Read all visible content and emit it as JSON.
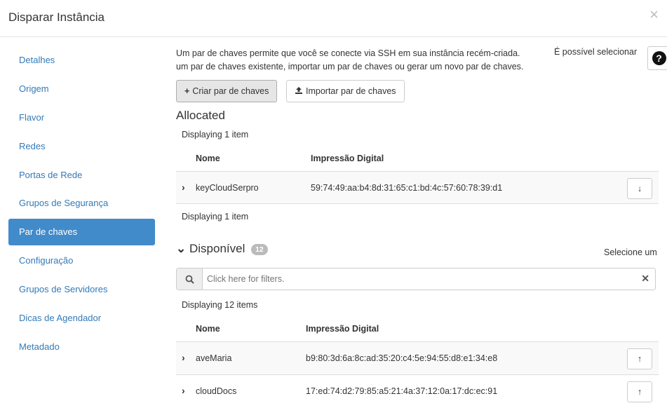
{
  "dialog": {
    "title": "Disparar Instância",
    "close_glyph": "×"
  },
  "sidebar": {
    "items": [
      {
        "label": "Detalhes"
      },
      {
        "label": "Origem"
      },
      {
        "label": "Flavor"
      },
      {
        "label": "Redes"
      },
      {
        "label": "Portas de Rede"
      },
      {
        "label": "Grupos de Segurança"
      },
      {
        "label": "Par de chaves"
      },
      {
        "label": "Configuração"
      },
      {
        "label": "Grupos de Servidores"
      },
      {
        "label": "Dicas de Agendador"
      },
      {
        "label": "Metadado"
      }
    ],
    "active_index": 6
  },
  "intro": {
    "line1": "Um par de chaves permite que você se conecte via SSH em sua instância recém-criada.",
    "line2": "um par de chaves existente, importar um par de chaves ou gerar um novo par de chaves.",
    "side_text": "É possível selecionar",
    "help_glyph": "?"
  },
  "buttons": {
    "create": {
      "icon": "plus-icon",
      "label": "Criar par de chaves"
    },
    "import": {
      "icon": "upload-icon",
      "label": "Importar par de chaves"
    }
  },
  "allocated": {
    "title": "Allocated",
    "displaying_top": "Displaying 1 item",
    "displaying_bottom": "Displaying 1 item",
    "columns": {
      "name": "Nome",
      "fingerprint": "Impressão Digital"
    },
    "rows": [
      {
        "name": "keyCloudSerpro",
        "fingerprint": "59:74:49:aa:b4:8d:31:65:c1:bd:4c:57:60:78:39:d1",
        "action_icon": "arrow-down-icon"
      }
    ]
  },
  "available": {
    "title": "Disponível",
    "count": "12",
    "select_hint": "Selecione um",
    "filter_placeholder": "Click here for filters.",
    "displaying": "Displaying 12 items",
    "columns": {
      "name": "Nome",
      "fingerprint": "Impressão Digital"
    },
    "rows": [
      {
        "name": "aveMaria",
        "fingerprint": "b9:80:3d:6a:8c:ad:35:20:c4:5e:94:55:d8:e1:34:e8",
        "action_icon": "arrow-up-icon"
      },
      {
        "name": "cloudDocs",
        "fingerprint": "17:ed:74:d2:79:85:a5:21:4a:37:12:0a:17:dc:ec:91",
        "action_icon": "arrow-up-icon"
      }
    ]
  },
  "colors": {
    "accent": "#428bca",
    "link": "#337ab7"
  }
}
